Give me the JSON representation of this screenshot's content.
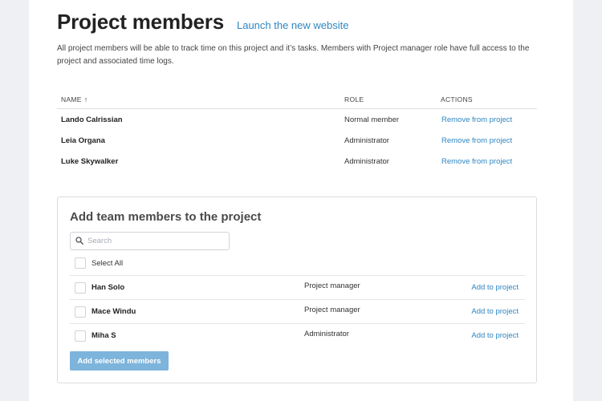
{
  "header": {
    "title": "Project members",
    "link": "Launch the new website"
  },
  "description": "All project members will be able to track time on this project and it’s tasks. Members with Project manager role have full access to the project and associated time logs.",
  "members_table": {
    "columns": {
      "name": "NAME",
      "role": "ROLE",
      "actions": "ACTIONS"
    },
    "sort_indicator": "↑",
    "rows": [
      {
        "name": "Lando Calrissian",
        "role": "Normal member",
        "action": "Remove from project"
      },
      {
        "name": "Leia Organa",
        "role": "Administrator",
        "action": "Remove from project"
      },
      {
        "name": "Luke Skywalker",
        "role": "Administrator",
        "action": "Remove from project"
      }
    ]
  },
  "add_panel": {
    "title": "Add team members to the project",
    "search": {
      "placeholder": "Search",
      "value": "",
      "icon": "search-icon"
    },
    "select_all_label": "Select All",
    "members": [
      {
        "name": "Han Solo",
        "role": "Project manager",
        "action": "Add to project"
      },
      {
        "name": "Mace Windu",
        "role": "Project manager",
        "action": "Add to project"
      },
      {
        "name": "Miha S",
        "role": "Administrator",
        "action": "Add to project"
      }
    ],
    "submit_label": "Add selected members"
  },
  "colors": {
    "link": "#2f86c2",
    "button": "#7db4db",
    "background": "#eef0f3"
  }
}
